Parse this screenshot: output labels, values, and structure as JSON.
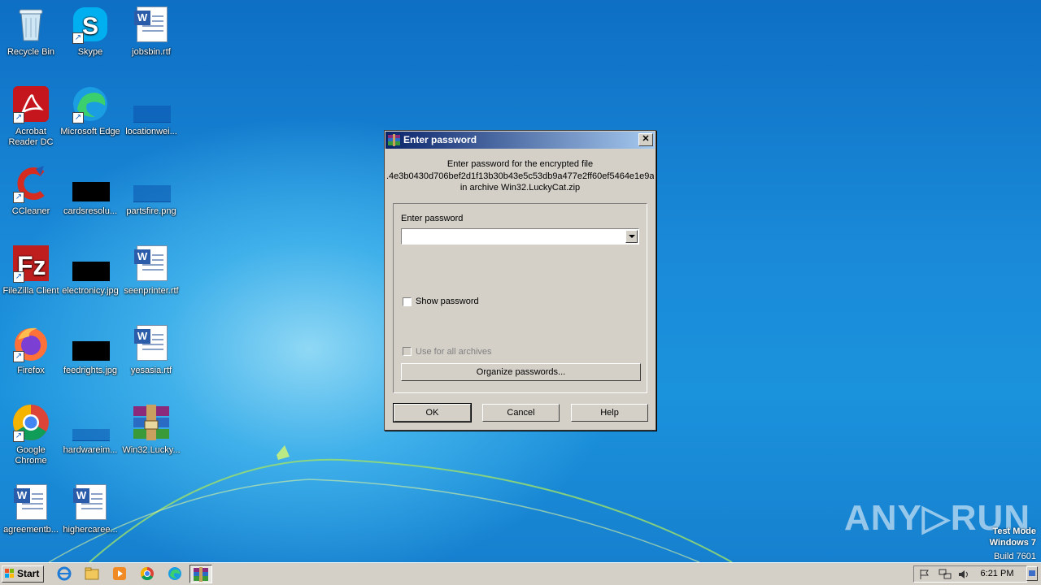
{
  "desktop": {
    "icons": [
      {
        "label": "Recycle Bin"
      },
      {
        "label": "Skype"
      },
      {
        "label": "jobsbin.rtf"
      },
      {
        "label": "Acrobat Reader DC"
      },
      {
        "label": "Microsoft Edge"
      },
      {
        "label": "locationwei..."
      },
      {
        "label": "CCleaner"
      },
      {
        "label": "cardsresolu..."
      },
      {
        "label": "partsfire.png"
      },
      {
        "label": "FileZilla Client"
      },
      {
        "label": "electronicy.jpg"
      },
      {
        "label": "seenprinter.rtf"
      },
      {
        "label": "Firefox"
      },
      {
        "label": "feedrights.jpg"
      },
      {
        "label": "yesasia.rtf"
      },
      {
        "label": "Google Chrome"
      },
      {
        "label": "hardwareim..."
      },
      {
        "label": "Win32.Lucky..."
      },
      {
        "label": "agreementb..."
      },
      {
        "label": "highercaree..."
      }
    ]
  },
  "dialog": {
    "title": "Enter password",
    "line1": "Enter password for the encrypted file",
    "line2": ".4e3b0430d706bef2d1f13b30b43e5c53db9a477e2ff60ef5464e1e9a",
    "line3": "in archive Win32.LuckyCat.zip",
    "field_label": "Enter password",
    "password_value": "",
    "show_password_label": "Show password",
    "use_all_label": "Use for all archives",
    "organize_label": "Organize passwords...",
    "ok_label": "OK",
    "cancel_label": "Cancel",
    "help_label": "Help",
    "close_glyph": "✕"
  },
  "taskbar": {
    "start_label": "Start",
    "clock": "6:21 PM"
  },
  "watermark": {
    "line1": "Test Mode",
    "line2": "Windows 7",
    "line3": "Build 7601",
    "brand": "ANY▷RUN"
  },
  "colors": {
    "titlebar_start": "#0a246a",
    "titlebar_end": "#a6caf0",
    "dialog_face": "#d4d0c8"
  }
}
